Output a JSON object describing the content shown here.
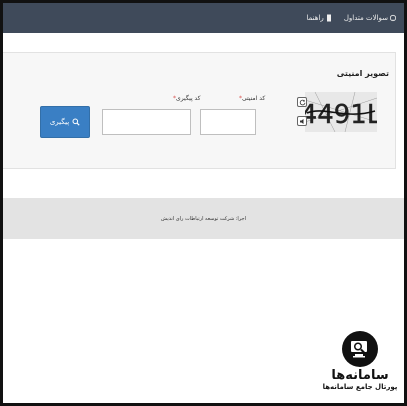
{
  "topbar": {
    "items": [
      {
        "label": "سوالات متداول",
        "icon": "question-icon"
      },
      {
        "label": "راهنما",
        "icon": "book-icon"
      }
    ]
  },
  "form": {
    "title": "تصویر امنیتی",
    "captcha": {
      "text": "4491L",
      "refresh_icon": "refresh-icon",
      "audio_icon": "audio-icon"
    },
    "security_code_label": "کد امنیتی",
    "tracking_code_label": "کد پیگیری",
    "required_mark": "*",
    "security_code_value": "",
    "tracking_code_value": "",
    "search_label": "پیگیری",
    "search_icon": "search-icon"
  },
  "footer": {
    "text": "اجرا: شرکت توسعه ارتباطات رای اندیش"
  },
  "brand": {
    "title": "سامانه‌ها",
    "subtitle": "پورتال جامع سامانه‌ها",
    "logo_icon": "magnifier-monitor-logo"
  },
  "colors": {
    "topbar": "#3f4a5a",
    "button": "#3a7fc4",
    "footer": "#e3e3e3",
    "required": "#d9534f"
  }
}
